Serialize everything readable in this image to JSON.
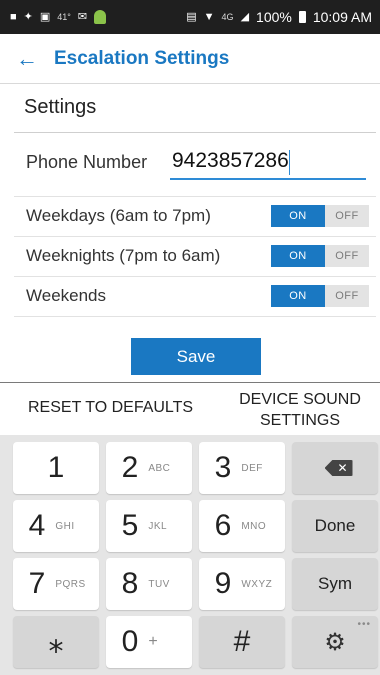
{
  "status_bar": {
    "temperature": "41°",
    "network": "4G",
    "battery": "100%",
    "time": "10:09 AM"
  },
  "app_bar": {
    "title": "Escalation Settings",
    "back_icon": "back-arrow-icon"
  },
  "settings": {
    "section_title": "Settings",
    "phone_label": "Phone Number",
    "phone_value": "9423857286",
    "schedules": [
      {
        "label": "Weekdays (6am to 7pm)",
        "on_label": "ON",
        "off_label": "OFF",
        "state": "on"
      },
      {
        "label": "Weeknights (7pm to 6am)",
        "on_label": "ON",
        "off_label": "OFF",
        "state": "on"
      },
      {
        "label": "Weekends",
        "on_label": "ON",
        "off_label": "OFF",
        "state": "on"
      }
    ]
  },
  "actions": {
    "save_label": "Save",
    "reset_label": "RESET TO DEFAULTS",
    "device_sound_label": "DEVICE SOUND SETTINGS"
  },
  "keypad": {
    "keys": [
      {
        "digit": "1",
        "letters": ""
      },
      {
        "digit": "2",
        "letters": "ABC"
      },
      {
        "digit": "3",
        "letters": "DEF"
      },
      {
        "digit": "4",
        "letters": "GHI"
      },
      {
        "digit": "5",
        "letters": "JKL"
      },
      {
        "digit": "6",
        "letters": "MNO"
      },
      {
        "digit": "7",
        "letters": "PQRS"
      },
      {
        "digit": "8",
        "letters": "TUV"
      },
      {
        "digit": "9",
        "letters": "WXYZ"
      },
      {
        "digit": "⁎",
        "letters": ""
      },
      {
        "digit": "0",
        "letters": "+"
      },
      {
        "digit": "#",
        "letters": ""
      }
    ],
    "backspace_icon": "backspace-icon",
    "done_label": "Done",
    "sym_label": "Sym",
    "settings_icon": "gear-icon"
  },
  "colors": {
    "accent": "#1a78c2",
    "toggle_off_bg": "#e3e3e3",
    "keypad_bg": "#e5e5e5"
  }
}
